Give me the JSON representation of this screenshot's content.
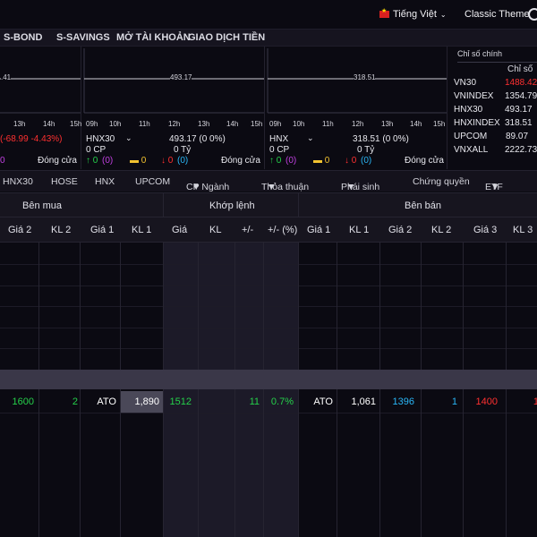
{
  "topbar": {
    "language": "Tiếng Việt",
    "theme": "Classic Theme"
  },
  "nav": [
    "S-BOND",
    "S-SAVINGS",
    "MỞ TÀI KHOẢN",
    "GIAO DỊCH TIỀN"
  ],
  "panels": [
    {
      "chart_value": ".41",
      "ticks": [
        "13h",
        "14h",
        "15h"
      ],
      "change": "(-68.99 -4.43%)",
      "status": "Đóng cửa",
      "counts_partial": "0"
    },
    {
      "name": "HNX30",
      "chart_value": "493.17",
      "ticks": [
        "09h",
        "10h",
        "11h",
        "12h",
        "13h",
        "14h",
        "15h"
      ],
      "value_change": "493.17  (0  0%)",
      "volume": "0 CP",
      "value": "0 Tỷ",
      "up": "0",
      "ceil": "(0)",
      "ref": "0",
      "down": "0",
      "floor": "(0)",
      "status": "Đóng cửa"
    },
    {
      "name": "HNX",
      "chart_value": "318.51",
      "ticks": [
        "09h",
        "10h",
        "11h",
        "12h",
        "13h",
        "14h",
        "15h"
      ],
      "value_change": "318.51  (0  0%)",
      "volume": "0 CP",
      "value": "0 Tỷ",
      "up": "0",
      "ceil": "(0)",
      "ref": "0",
      "down": "0",
      "floor": "(0)",
      "status": "Đóng cửa"
    }
  ],
  "index_list": {
    "tab": "Chỉ số chính",
    "col": "Chỉ số",
    "rows": [
      {
        "name": "VN30",
        "value": "1488.42",
        "color": "#ff3030"
      },
      {
        "name": "VNINDEX",
        "value": "1354.79",
        "color": "#e8e8ee"
      },
      {
        "name": "HNX30",
        "value": "493.17",
        "color": "#e8e8ee"
      },
      {
        "name": "HNXINDEX",
        "value": "318.51",
        "color": "#e8e8ee"
      },
      {
        "name": "UPCOM",
        "value": "89.07",
        "color": "#e8e8ee"
      },
      {
        "name": "VNXALL",
        "value": "2222.73",
        "color": "#e8e8ee"
      }
    ]
  },
  "tabs": [
    "HNX30",
    "HOSE",
    "HNX",
    "UPCOM",
    "CP Ngành",
    "Thỏa thuận",
    "Phái sinh",
    "Chứng quyền",
    "ETF"
  ],
  "table": {
    "groups": {
      "buy": "Bên mua",
      "match": "Khớp lệnh",
      "sell": "Bên bán"
    },
    "columns": [
      "Giá 2",
      "KL 2",
      "Giá 1",
      "KL 1",
      "Giá",
      "KL",
      "+/-",
      "+/- (%)",
      "Giá 1",
      "KL 1",
      "Giá 2",
      "KL 2",
      "Giá 3",
      "KL 3"
    ],
    "row": {
      "buy_price2": "1600",
      "buy_vol2": "2",
      "buy_price1": "ATO",
      "buy_vol1": "1,890",
      "match_price": "1512",
      "match_change": "11",
      "match_pct": "0.7%",
      "sell_price1": "ATO",
      "sell_vol1": "1,061",
      "sell_price2": "1396",
      "sell_vol2": "1",
      "sell_price3": "1400",
      "sell_vol3": "1"
    }
  }
}
